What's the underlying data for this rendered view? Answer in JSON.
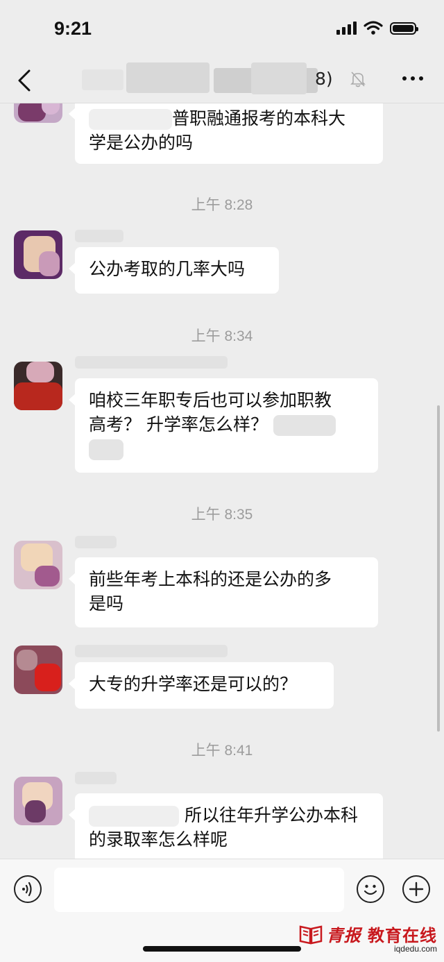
{
  "status_bar": {
    "time": "9:21"
  },
  "nav": {
    "title_suffix": "8)"
  },
  "messages": [
    {
      "text_line1": "普职融通报考的本科大",
      "text_line2": "学是公办的吗"
    },
    {
      "timestamp": "上午 8:28"
    },
    {
      "text": "公办考取的几率大吗"
    },
    {
      "timestamp": "上午 8:34"
    },
    {
      "text_line1": "咱校三年职专后也可以参加职教",
      "text_line2": "高考？  升学率怎么样？"
    },
    {
      "timestamp": "上午 8:35"
    },
    {
      "text_line1": "前些年考上本科的还是公办的多",
      "text_line2": "是吗"
    },
    {
      "text": "大专的升学率还是可以的？"
    },
    {
      "timestamp": "上午 8:41"
    },
    {
      "text_line1": "所以往年升学公办本科",
      "text_line2": "的录取率怎么样呢"
    }
  ],
  "input": {
    "placeholder": ""
  },
  "watermark": {
    "name_left": "青报",
    "name_right": "教育在线",
    "url": "iqdedu.com",
    "color": "#c8191e"
  }
}
